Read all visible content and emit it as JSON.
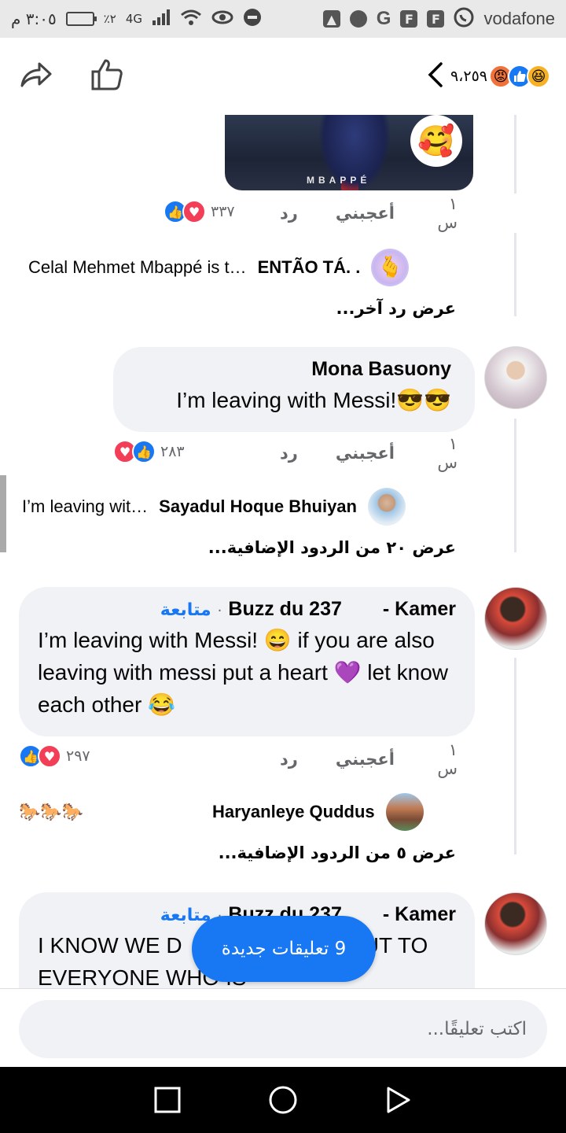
{
  "status_bar": {
    "time": "٣:٠٥ م",
    "battery_percent": "٪٢",
    "network": "4G",
    "carrier": "vodafone",
    "brand_icons": [
      "F",
      "F",
      "G"
    ]
  },
  "post_header": {
    "reaction_count": "٩،٢٥٩",
    "reactions": [
      "haha",
      "like",
      "angry"
    ],
    "share_icon": "share-icon",
    "like_icon": "thumbs-up-icon",
    "back_icon": "chevron-left-icon"
  },
  "media": {
    "caption": "MBAPPÉ",
    "sticker": "🥰"
  },
  "comments": [
    {
      "meta": {
        "time": "١ س",
        "like": "أعجبني",
        "reply": "رد",
        "reaction_count": "٣٣٧"
      },
      "reply_preview": {
        "name": "ENTÃO TÁ. .",
        "text": "Celal Mehmet Mbappé is t…"
      },
      "more_link": "عرض رد آخر..."
    },
    {
      "author": "Mona Basuony",
      "body": "I’m leaving with Messi!😎😎",
      "meta": {
        "time": "١ س",
        "like": "أعجبني",
        "reply": "رد",
        "reaction_count": "٢٨٣"
      },
      "reply_preview": {
        "name": "Sayadul Hoque Bhuiyan",
        "text": "I’m leaving wit…"
      },
      "more_link": "عرض ٢٠ من الردود الإضافية..."
    },
    {
      "author": "Kamer -",
      "author_second": "Buzz du 237",
      "follow": "متابعة",
      "body": "I’m leaving with Messi! 😄 if you are also leaving with messi put a heart 💜 let know each other 😂",
      "meta": {
        "time": "١ س",
        "like": "أعجبني",
        "reply": "رد",
        "reaction_count": "٢٩٧"
      },
      "reply_preview": {
        "name": "Haryanleye Quddus",
        "text": "🐎🐎🐎"
      },
      "more_link": "عرض ٥ من الردود الإضافية..."
    },
    {
      "author": "Kamer -",
      "author_second": "Buzz du 237",
      "follow": "متابعة",
      "body": "I KNOW WE D          H OTHER BUT TO EVERYONE WHO IS"
    }
  ],
  "new_comments_button": "9 تعليقات جديدة",
  "composer": {
    "placeholder": "اكتب تعليقًا..."
  },
  "colors": {
    "accent": "#1877f2",
    "bubble": "#f0f2f5",
    "love": "#f33e58",
    "secondary_text": "#65676b"
  }
}
